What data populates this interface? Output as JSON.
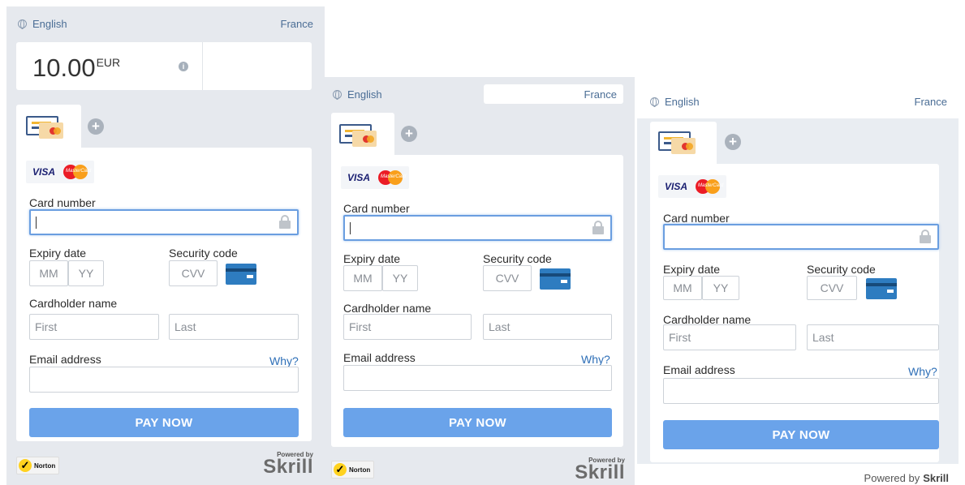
{
  "colors": {
    "accent": "#6aa3ea",
    "link": "#2e6fb7",
    "panel_bg": "#e6e9ee",
    "active_border": "#6a9ee0"
  },
  "common": {
    "language": "English",
    "country": "France",
    "card_number_label": "Card number",
    "expiry_label": "Expiry date",
    "expiry_month_placeholder": "MM",
    "expiry_year_placeholder": "YY",
    "security_label": "Security code",
    "cvv_placeholder": "CVV",
    "cardholder_label": "Cardholder name",
    "first_placeholder": "First",
    "last_placeholder": "Last",
    "email_label": "Email address",
    "why_link": "Why?",
    "pay_button": "PAY NOW",
    "visa": "VISA",
    "mastercard": "MasterCard",
    "norton": "Norton",
    "powered_by": "Powered by",
    "skrill": "Skrill"
  },
  "panel1": {
    "amount": "10.00",
    "currency": "EUR"
  }
}
